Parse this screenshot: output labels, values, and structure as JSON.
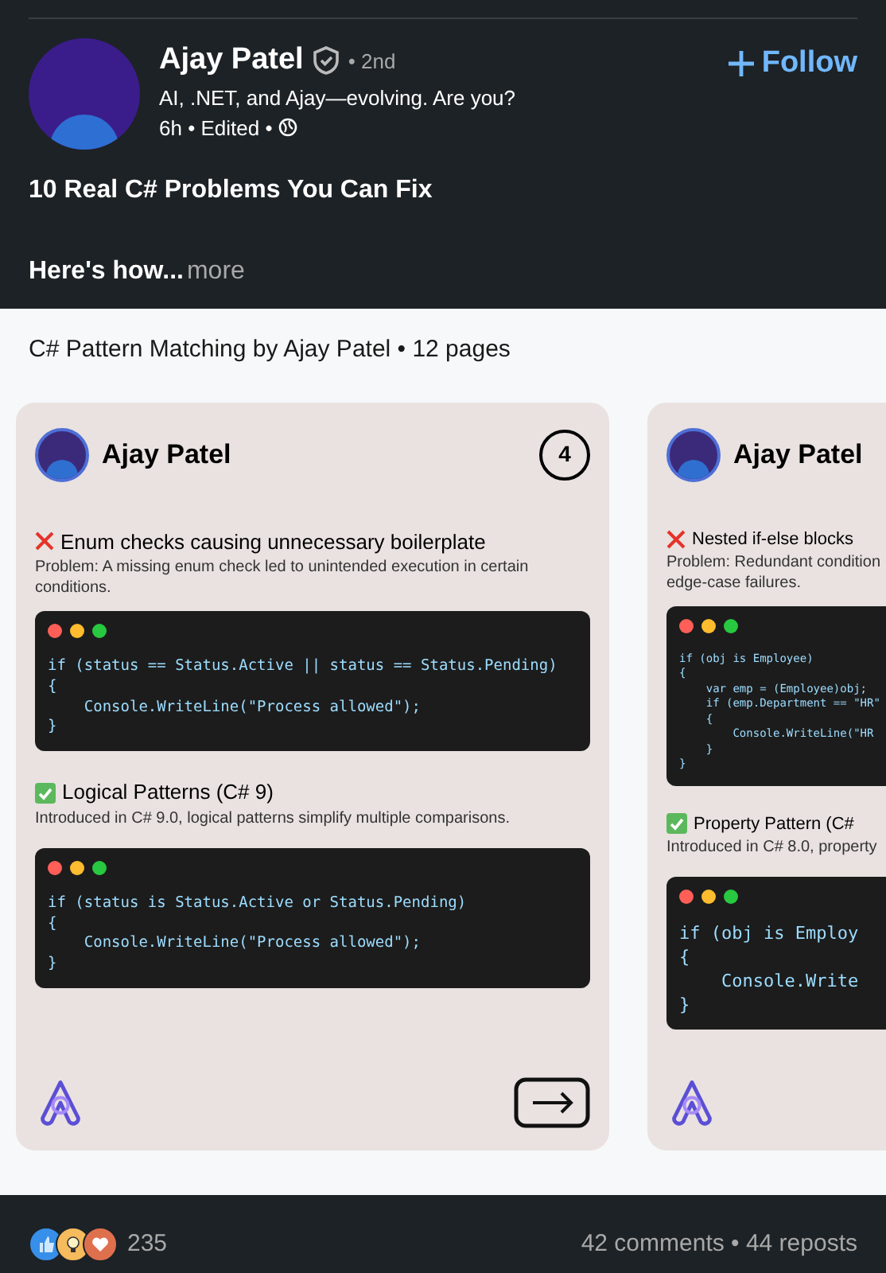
{
  "author": {
    "name": "Ajay Patel",
    "degree": "• 2nd",
    "headline": "AI, .NET, and Ajay—evolving. Are you?",
    "meta": "6h • Edited •"
  },
  "follow_button": {
    "label": "Follow"
  },
  "post": {
    "title": "10 Real C# Problems You Can Fix",
    "teaser": "Here's how...",
    "more": "more"
  },
  "document": {
    "title": "C# Pattern Matching by Ajay Patel • 12 pages",
    "slides": [
      {
        "author": "Ajay Patel",
        "page": "4",
        "problem": "Enum checks causing unnecessary boilerplate",
        "problem_text": "Problem: A missing enum check led to unintended execution in certain conditions.",
        "code_before": [
          "if (status == Status.Active || status == Status.Pending)",
          "{",
          "    Console.WriteLine(\"Process allowed\");",
          "}"
        ],
        "solution": "Logical Patterns (C# 9)",
        "solution_text": "Introduced in C# 9.0, logical patterns simplify multiple comparisons.",
        "code_after": [
          "if (status is Status.Active or Status.Pending)",
          "{",
          "    Console.WriteLine(\"Process allowed\");",
          "}"
        ]
      },
      {
        "author": "Ajay Patel",
        "problem": "Nested if-else blocks",
        "problem_text": "Problem: Redundant condition\nedge-case failures.",
        "code_before": [
          "if (obj is Employee)",
          "{",
          "    var emp = (Employee)obj;",
          "    if (emp.Department == \"HR\"",
          "    {",
          "        Console.WriteLine(\"HR",
          "    }",
          "}"
        ],
        "solution": "Property Pattern (C#",
        "solution_text": "Introduced in C# 8.0, property",
        "code_after": [
          "if (obj is Employ",
          "{",
          "    Console.Write",
          "}"
        ]
      }
    ]
  },
  "social": {
    "reactions": "235",
    "comments": "42 comments • 44 reposts"
  }
}
